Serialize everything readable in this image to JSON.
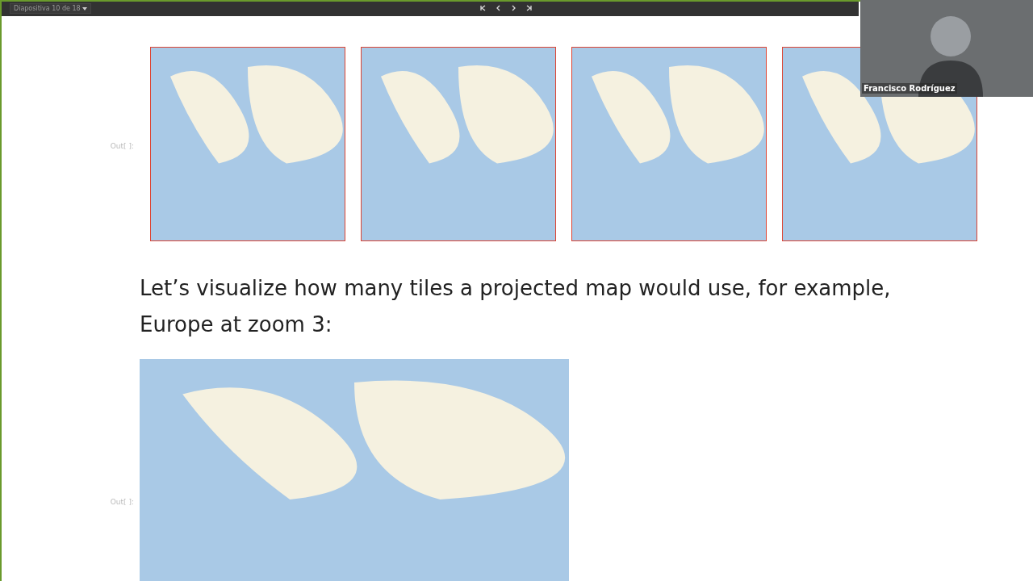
{
  "toolbar": {
    "slide_selector": "Diapositiva 10 de 18",
    "nav_buttons": [
      {
        "kind": "first"
      },
      {
        "kind": "prev"
      },
      {
        "kind": "next"
      },
      {
        "kind": "last"
      }
    ]
  },
  "cells": [
    {
      "kind": "maps",
      "prompt": "Out[ ]:",
      "maps": [
        {
          "kind": "world"
        },
        {
          "kind": "world"
        },
        {
          "kind": "world"
        },
        {
          "kind": "world"
        }
      ]
    },
    {
      "kind": "text",
      "text": "Let’s visualize how many tiles a projected map would use, for example, Europe at zoom 3:"
    },
    {
      "kind": "bigmap",
      "prompt": "Out[ ]:"
    }
  ],
  "webcam": {
    "name": "Francisco Rodríguez"
  }
}
